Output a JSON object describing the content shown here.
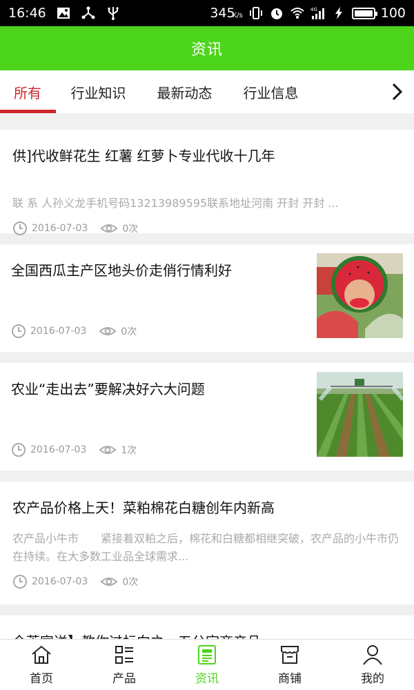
{
  "status_bar": {
    "time": "16:46",
    "net_speed": "345",
    "net_speed_unit": "K/s",
    "battery": "100"
  },
  "header": {
    "title": "资讯"
  },
  "tabs": [
    {
      "label": "所有",
      "active": true
    },
    {
      "label": "行业知识"
    },
    {
      "label": "最新动态"
    },
    {
      "label": "行业信息"
    }
  ],
  "articles": [
    {
      "title": "供]代收鲜花生 红薯 红萝卜专业代收十几年",
      "summary": "联 系 人孙义龙手机号码13213989595联系地址河南 开封 开封 ...",
      "date": "2016-07-03",
      "views": "0次",
      "image": ""
    },
    {
      "title": "全国西瓜主产区地头价走俏行情利好",
      "summary": "",
      "date": "2016-07-03",
      "views": "0次",
      "image": "watermelon-photo"
    },
    {
      "title": "农业“走出去”要解决好六大问题",
      "summary": "",
      "date": "2016-07-03",
      "views": "1次",
      "image": "farm-field-photo"
    },
    {
      "title": "农产品价格上天！菜粕棉花白糖创年内新高",
      "summary": "农产品小牛市　　紧接着双粕之后，棉花和白糖都相继突破，农产品的小牛市仍在持续。在大多数工业品全球需求...",
      "date": "2016-07-03",
      "views": "0次",
      "image": ""
    },
    {
      "title": "企莱宣送】教你过标向之一五分宗商产品",
      "summary": "",
      "date": "",
      "views": "",
      "image": ""
    }
  ],
  "bottom_nav": [
    {
      "label": "首页",
      "icon": "home-icon"
    },
    {
      "label": "产品",
      "icon": "product-list-icon"
    },
    {
      "label": "资讯",
      "icon": "news-icon",
      "active": true
    },
    {
      "label": "商铺",
      "icon": "shop-icon"
    },
    {
      "label": "我的",
      "icon": "user-icon"
    }
  ],
  "colors": {
    "brand_green": "#4dd51b",
    "active_tab_red": "#d1242a",
    "summary_gray": "#aaaaaa"
  }
}
